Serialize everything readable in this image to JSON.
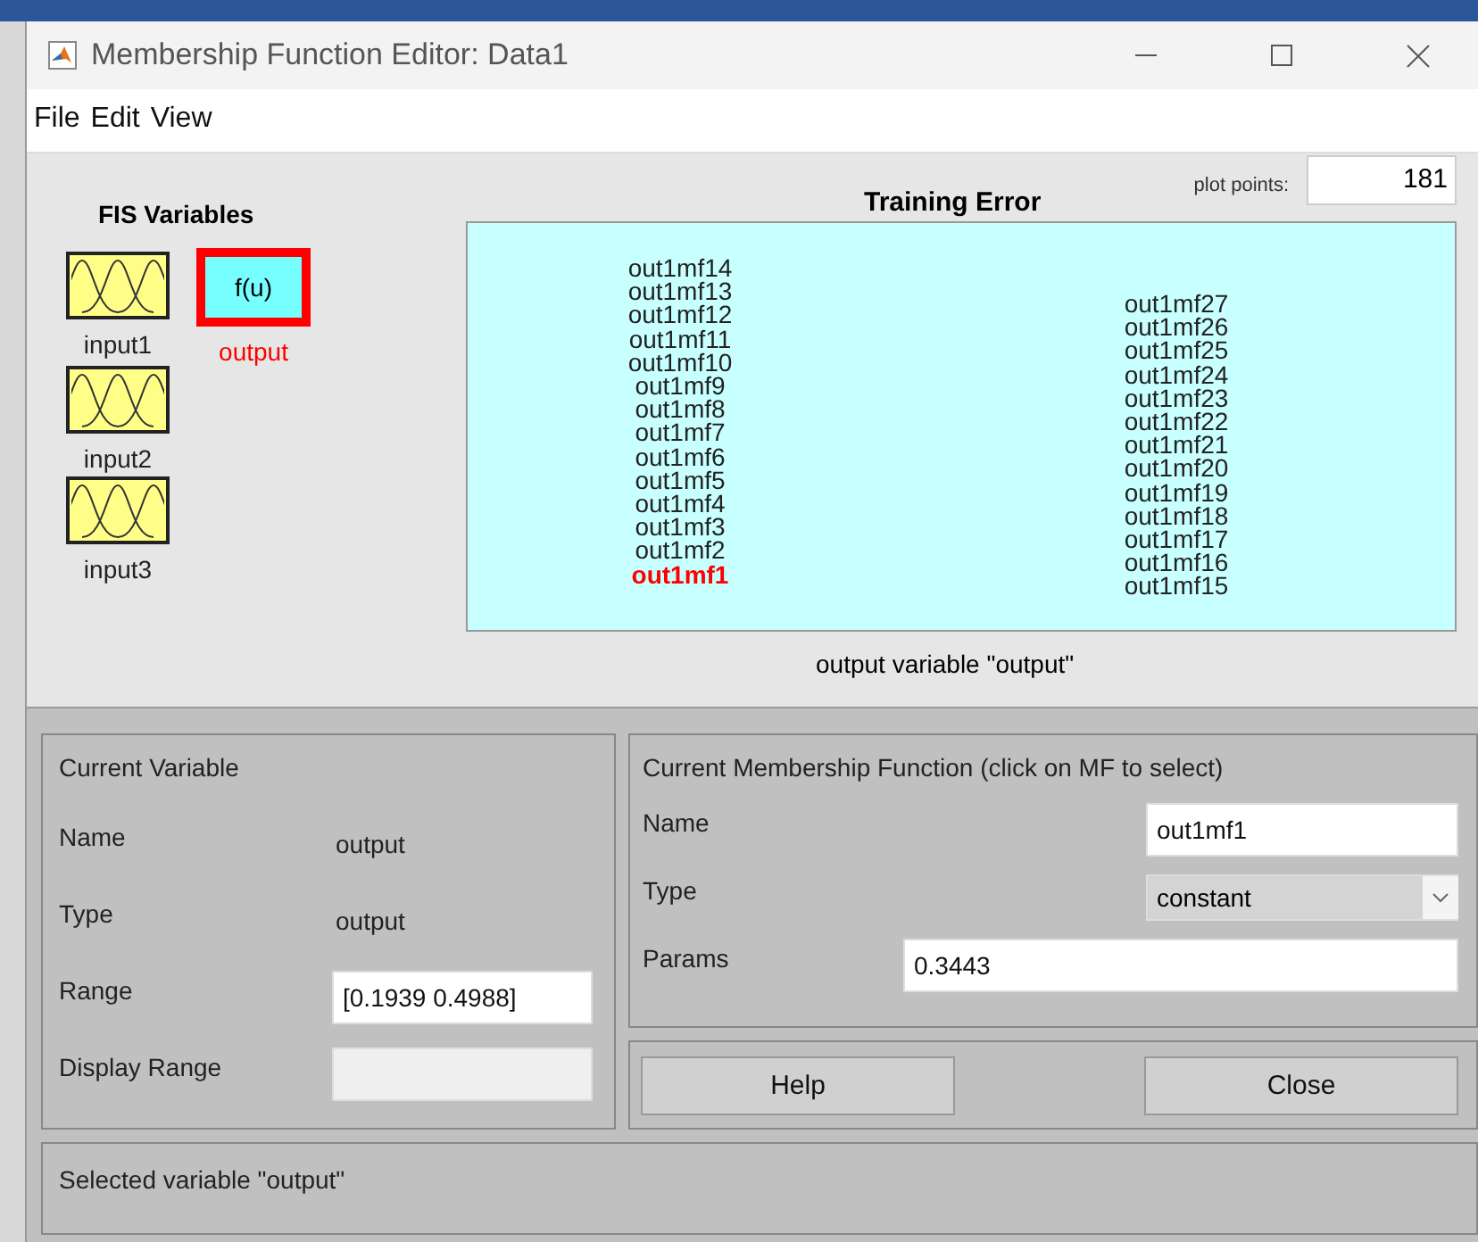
{
  "window": {
    "title": "Membership Function Editor: Data1"
  },
  "menu": [
    "File",
    "Edit",
    "View"
  ],
  "fis_variables": {
    "title": "FIS Variables",
    "variables": [
      {
        "name": "input1",
        "kind": "input",
        "selected": false
      },
      {
        "name": "input2",
        "kind": "input",
        "selected": false
      },
      {
        "name": "input3",
        "kind": "input",
        "selected": false
      },
      {
        "name": "output",
        "kind": "output",
        "label": "f(u)",
        "selected": true
      }
    ]
  },
  "plot": {
    "title": "Training Error",
    "plot_points_label": "plot points:",
    "plot_points": "181",
    "caption": "output variable \"output\"",
    "mf_columns": [
      [
        {
          "label": "out1mf14",
          "selected": false
        },
        {
          "label": "out1mf13",
          "selected": false
        },
        {
          "label": "out1mf12",
          "selected": false
        },
        {
          "label": "out1mf11",
          "selected": false
        },
        {
          "label": "out1mf10",
          "selected": false
        },
        {
          "label": "out1mf9",
          "selected": false
        },
        {
          "label": "out1mf8",
          "selected": false
        },
        {
          "label": "out1mf7",
          "selected": false
        },
        {
          "label": "out1mf6",
          "selected": false
        },
        {
          "label": "out1mf5",
          "selected": false
        },
        {
          "label": "out1mf4",
          "selected": false
        },
        {
          "label": "out1mf3",
          "selected": false
        },
        {
          "label": "out1mf2",
          "selected": false
        },
        {
          "label": "out1mf1",
          "selected": true
        }
      ],
      [
        {
          "label": "out1mf27",
          "selected": false
        },
        {
          "label": "out1mf26",
          "selected": false
        },
        {
          "label": "out1mf25",
          "selected": false
        },
        {
          "label": "out1mf24",
          "selected": false
        },
        {
          "label": "out1mf23",
          "selected": false
        },
        {
          "label": "out1mf22",
          "selected": false
        },
        {
          "label": "out1mf21",
          "selected": false
        },
        {
          "label": "out1mf20",
          "selected": false
        },
        {
          "label": "out1mf19",
          "selected": false
        },
        {
          "label": "out1mf18",
          "selected": false
        },
        {
          "label": "out1mf17",
          "selected": false
        },
        {
          "label": "out1mf16",
          "selected": false
        },
        {
          "label": "out1mf15",
          "selected": false
        }
      ]
    ]
  },
  "current_variable": {
    "title": "Current Variable",
    "name_label": "Name",
    "name": "output",
    "type_label": "Type",
    "type": "output",
    "range_label": "Range",
    "range": "[0.1939 0.4988]",
    "display_range_label": "Display Range",
    "display_range_disabled": true
  },
  "current_mf": {
    "title": "Current Membership Function (click on MF to select)",
    "name_label": "Name",
    "name": "out1mf1",
    "type_label": "Type",
    "type": "constant",
    "params_label": "Params",
    "params": "0.3443"
  },
  "buttons": [
    "Help",
    "Close"
  ],
  "status": "Selected variable \"output\""
}
